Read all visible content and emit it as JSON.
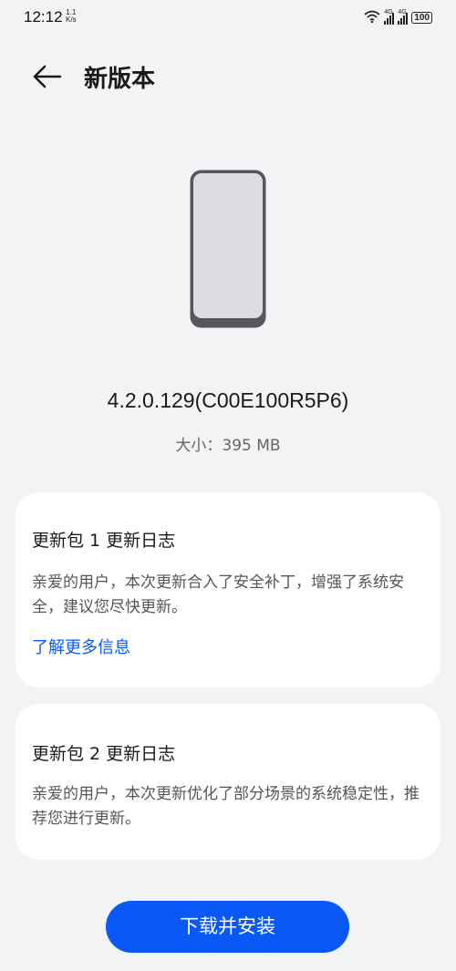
{
  "status_bar": {
    "time": "12:12",
    "net_speed_value": "1.1",
    "net_speed_unit": "K/s",
    "network_type_1": "4G",
    "network_type_2": "4G",
    "battery": "100"
  },
  "header": {
    "title": "新版本",
    "back_icon": "back-arrow-icon"
  },
  "update": {
    "version": "4.2.0.129(C00E100R5P6)",
    "size_label": "大小：395 MB",
    "illustration_icon": "phone-icon"
  },
  "changelogs": [
    {
      "title": "更新包 1 更新日志",
      "body": "亲爱的用户，本次更新合入了安全补丁，增强了系统安全，建议您尽快更新。",
      "link": "了解更多信息"
    },
    {
      "title": "更新包 2 更新日志",
      "body": "亲爱的用户，本次更新优化了部分场景的系统稳定性，推荐您进行更新。"
    }
  ],
  "actions": {
    "install_label": "下载并安装"
  },
  "colors": {
    "accent": "#0a59f7",
    "background": "#f1f3f5",
    "card": "#ffffff"
  }
}
